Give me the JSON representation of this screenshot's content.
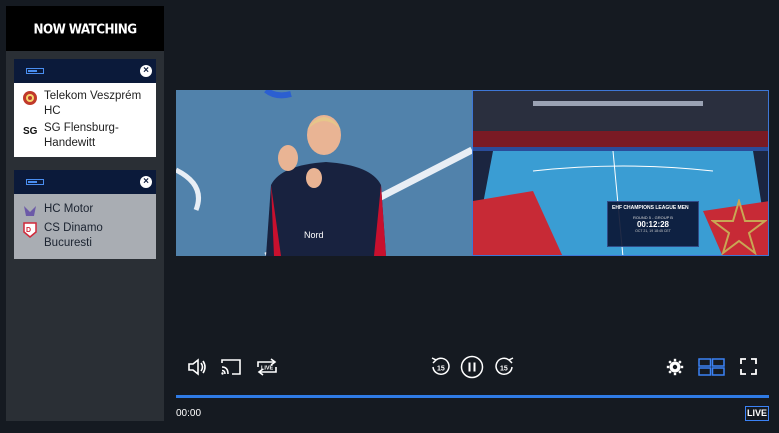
{
  "sidebar": {
    "header": "NOW WATCHING",
    "cards": [
      {
        "state": "active",
        "teams": [
          "Telekom Veszprém HC",
          "SG Flensburg-Handewitt"
        ]
      },
      {
        "state": "inactive",
        "teams": [
          "HC Motor",
          "CS Dinamo Bucuresti"
        ]
      }
    ]
  },
  "video": {
    "scorebug": {
      "title": "EHF CHAMPIONS LEAGUE MEN",
      "round": "ROUND 5 - GROUP B",
      "clock": "00:12:28",
      "date": "OCT 21, 19 18:45 CET"
    }
  },
  "controls": {
    "time": "00:00",
    "live": "LIVE",
    "icons": [
      "volume-icon",
      "cast-icon",
      "live-rewind-icon",
      "rewind-15-icon",
      "pause-icon",
      "forward-15-icon",
      "settings-icon",
      "multiview-layout-icon",
      "fullscreen-icon"
    ],
    "accent": "#2f7be6"
  }
}
